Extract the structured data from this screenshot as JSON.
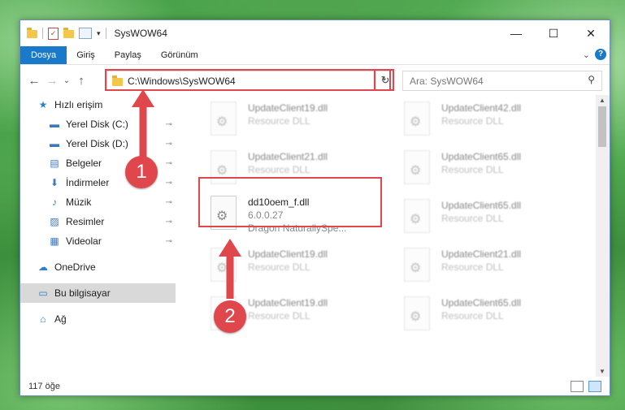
{
  "window": {
    "title": "SysWOW64"
  },
  "window_controls": {
    "minimize": "—",
    "maximize": "☐",
    "close": "✕"
  },
  "ribbon": {
    "tabs": [
      "Dosya",
      "Giriş",
      "Paylaş",
      "Görünüm"
    ],
    "expand": "⌄",
    "help": "?"
  },
  "nav": {
    "back": "←",
    "forward": "→",
    "recent": "⌄",
    "up": "↑"
  },
  "address": {
    "path": "C:\\Windows\\SysWOW64",
    "dropdown": "⌄",
    "refresh": "↻"
  },
  "search": {
    "placeholder": "Ara: SysWOW64",
    "icon": "search-icon",
    "glyph": "⚲"
  },
  "sidebar": {
    "quick_access": {
      "label": "Hızlı erişim",
      "glyph": "★"
    },
    "items": [
      {
        "label": "Yerel Disk (C:)",
        "icon": "drive-icon",
        "glyph": "▬",
        "pinned": true
      },
      {
        "label": "Yerel Disk (D:)",
        "icon": "drive-icon",
        "glyph": "▬",
        "pinned": true
      },
      {
        "label": "Belgeler",
        "icon": "documents-icon",
        "glyph": "▤",
        "pinned": true
      },
      {
        "label": "İndirmeler",
        "icon": "download-icon",
        "glyph": "⬇",
        "pinned": true
      },
      {
        "label": "Müzik",
        "icon": "music-icon",
        "glyph": "♪",
        "pinned": true
      },
      {
        "label": "Resimler",
        "icon": "pictures-icon",
        "glyph": "▨",
        "pinned": true
      },
      {
        "label": "Videolar",
        "icon": "videos-icon",
        "glyph": "▦",
        "pinned": true
      }
    ],
    "onedrive": {
      "label": "OneDrive",
      "glyph": "☁"
    },
    "this_pc": {
      "label": "Bu bilgisayar",
      "glyph": "▭"
    },
    "network": {
      "label": "Ağ",
      "glyph": "⌂"
    },
    "pin_glyph": "📌"
  },
  "files": [
    {
      "name": "UpdateClient19.dll",
      "desc": "Resource DLL",
      "col": 0,
      "row": 0
    },
    {
      "name": "UpdateClient42.dll",
      "desc": "Resource DLL",
      "col": 1,
      "row": 0
    },
    {
      "name": "UpdateClient21.dll",
      "desc": "Resource DLL",
      "col": 0,
      "row": 1
    },
    {
      "name": "UpdateClient65.dll",
      "desc": "Resource DLL",
      "col": 1,
      "row": 1
    },
    {
      "name": "UpdateClient65.dll",
      "desc": "Resource DLL",
      "col": 1,
      "row": 2
    },
    {
      "name": "UpdateClient19.dll",
      "desc": "Resource DLL",
      "col": 0,
      "row": 3
    },
    {
      "name": "UpdateClient21.dll",
      "desc": "Resource DLL",
      "col": 1,
      "row": 3
    },
    {
      "name": "UpdateClient19.dll",
      "desc": "Resource DLL",
      "col": 0,
      "row": 4
    },
    {
      "name": "UpdateClient65.dll",
      "desc": "Resource DLL",
      "col": 1,
      "row": 4
    }
  ],
  "highlighted_file": {
    "name": "dd10oem_f.dll",
    "version": "6.0.0.27",
    "company": "Dragon NaturallySpe..."
  },
  "status": {
    "count": "117 öğe"
  },
  "markers": {
    "one": "1",
    "two": "2"
  },
  "colors": {
    "accent": "#1979ca",
    "highlight": "#e0474c"
  }
}
